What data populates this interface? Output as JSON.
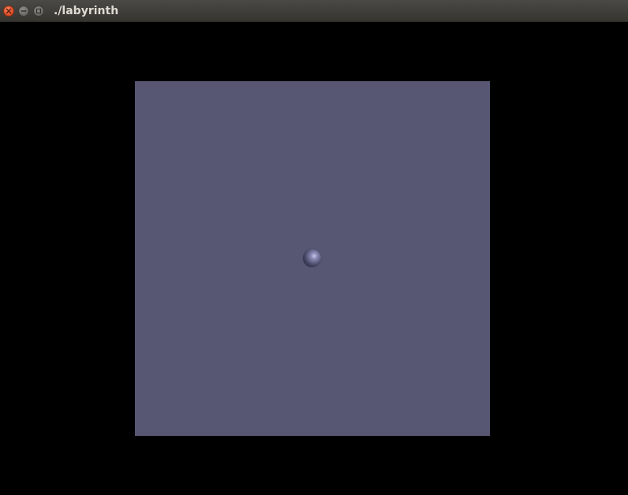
{
  "window": {
    "title": "./labyrinth",
    "buttons": {
      "close_icon": "close-icon",
      "minimize_icon": "minimize-icon",
      "maximize_icon": "maximize-icon"
    }
  },
  "scene": {
    "background_color": "#000000",
    "board_color": "#575774",
    "ball_color": "#8d8db8"
  }
}
